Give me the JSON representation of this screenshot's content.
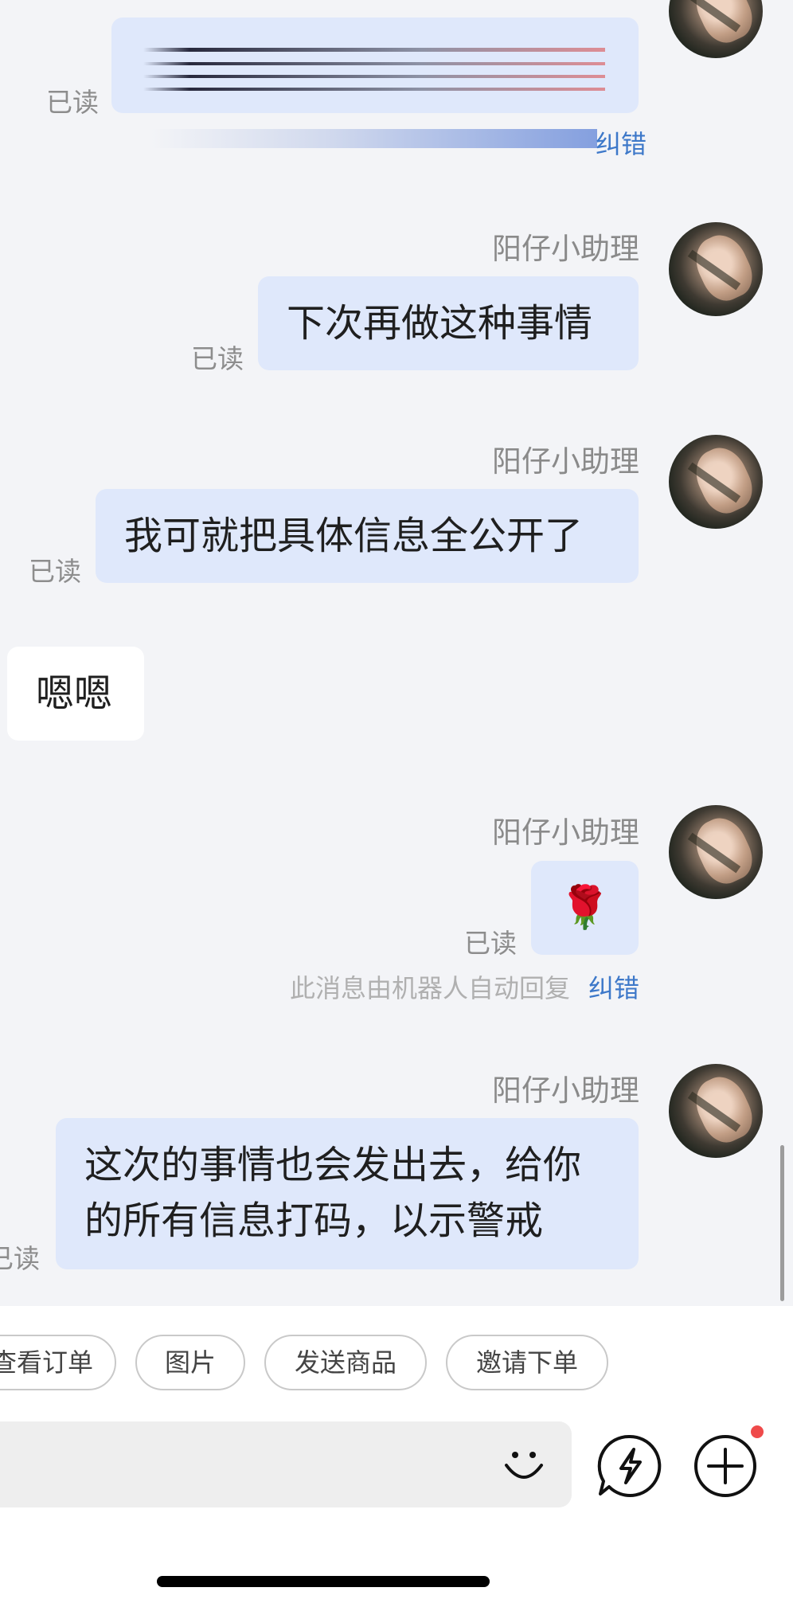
{
  "messages": [
    {
      "read": "已读",
      "note_visible": "纠错"
    },
    {
      "sender": "阳仔小助理",
      "text": "下次再做这种事情",
      "read": "已读"
    },
    {
      "sender": "阳仔小助理",
      "text": "我可就把具体信息全公开了",
      "read": "已读"
    },
    {
      "text": "嗯嗯"
    },
    {
      "sender": "阳仔小助理",
      "emoji": "🌹",
      "read": "已读",
      "note": "此消息由机器人自动回复",
      "note_link": "纠错"
    },
    {
      "sender": "阳仔小助理",
      "text_line1": "这次的事情也会发出去，给你",
      "text_line2": "的所有信息打码，以示警戒",
      "read": "已读"
    }
  ],
  "quick_actions": [
    "查看订单",
    "图片",
    "发送商品",
    "邀请下单"
  ],
  "icons": {
    "emoji": "smile-icon",
    "quick_reply": "lightning-bubble-icon",
    "more": "plus-circle-icon"
  },
  "colors": {
    "bubble_outgoing": "#dfe8fb",
    "bubble_incoming": "#ffffff",
    "link": "#3d78c9",
    "badge": "#ef4a4a"
  }
}
